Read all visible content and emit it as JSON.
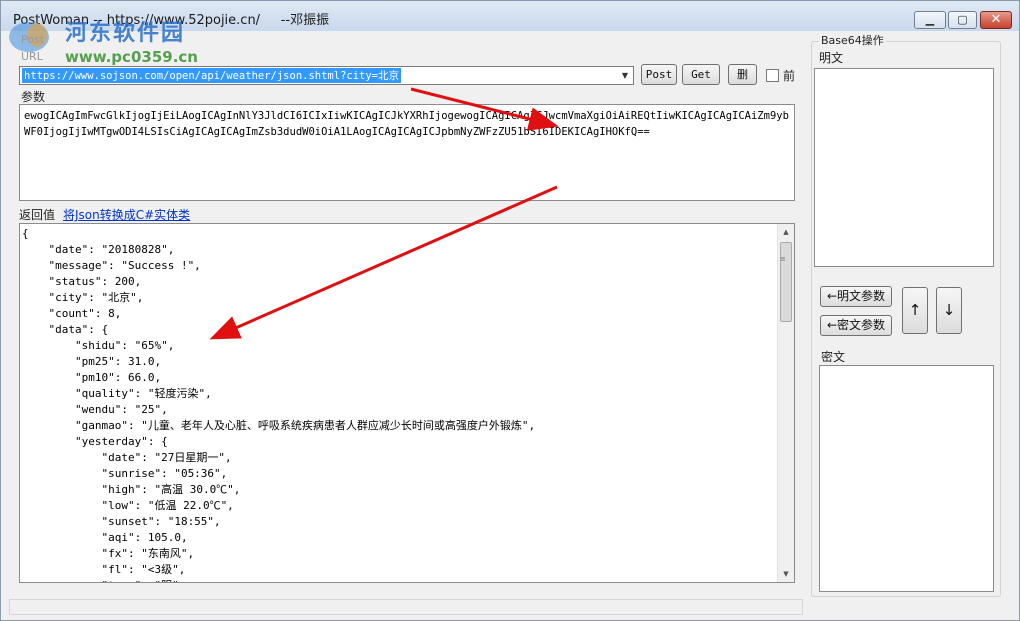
{
  "window": {
    "title": "PostWoman -- https://www.52pojie.cn/     --邓振振",
    "minimize": "▁",
    "maximize": "▢",
    "close": "✕"
  },
  "watermark": {
    "name": "河东软件园",
    "url": "www.pc0359.cn"
  },
  "labels": {
    "post": "Post",
    "url": "URL",
    "params": "参数",
    "response": "返回值"
  },
  "url_field": {
    "value": "https://www.sojson.com/open/api/weather/json.shtml?city=北京"
  },
  "toolbar": {
    "post": "Post",
    "get": "Get",
    "delete": "删",
    "front": "前"
  },
  "params_value": "ewogICAgImFwcGlkIjogIjEiLAogICAgInNlY3JldCI6ICIxIiwKICAgICJkYXRhIjogewogICAgICAgICJwcmVmaXgiOiAiREQtIiwKICAgICAgICAiZm9ybWF0IjogIjIwMTgwODI4LSIsCiAgICAgICAgImZsb3dudW0iOiA1LAogICAgICAgICJpbmNyZWFzZU51bSI6IDEKICAgIHOKfQ==",
  "convert_link": "将Json转换成C#实体类",
  "json_lines": [
    "{",
    "    \"date\": \"20180828\",",
    "    \"message\": \"Success !\",",
    "    \"status\": 200,",
    "    \"city\": \"北京\",",
    "    \"count\": 8,",
    "    \"data\": {",
    "        \"shidu\": \"65%\",",
    "        \"pm25\": 31.0,",
    "        \"pm10\": 66.0,",
    "        \"quality\": \"轻度污染\",",
    "        \"wendu\": \"25\",",
    "        \"ganmao\": \"儿童、老年人及心脏、呼吸系统疾病患者人群应减少长时间或高强度户外锻炼\",",
    "        \"yesterday\": {",
    "            \"date\": \"27日星期一\",",
    "            \"sunrise\": \"05:36\",",
    "            \"high\": \"高温 30.0℃\",",
    "            \"low\": \"低温 22.0℃\",",
    "            \"sunset\": \"18:55\",",
    "            \"aqi\": 105.0,",
    "            \"fx\": \"东南风\",",
    "            \"fl\": \"<3级\",",
    "            \"type\": \"阴\","
  ],
  "base64": {
    "title": "Base64操作",
    "plain_label": "明文",
    "cipher_label": "密文",
    "plain_param_btn": "←明文参数",
    "cipher_param_btn": "←密文参数",
    "up": "↑",
    "down": "↓"
  },
  "colors": {
    "selection": "#3399ff",
    "link": "#0033cc",
    "arrow": "#e01010"
  }
}
